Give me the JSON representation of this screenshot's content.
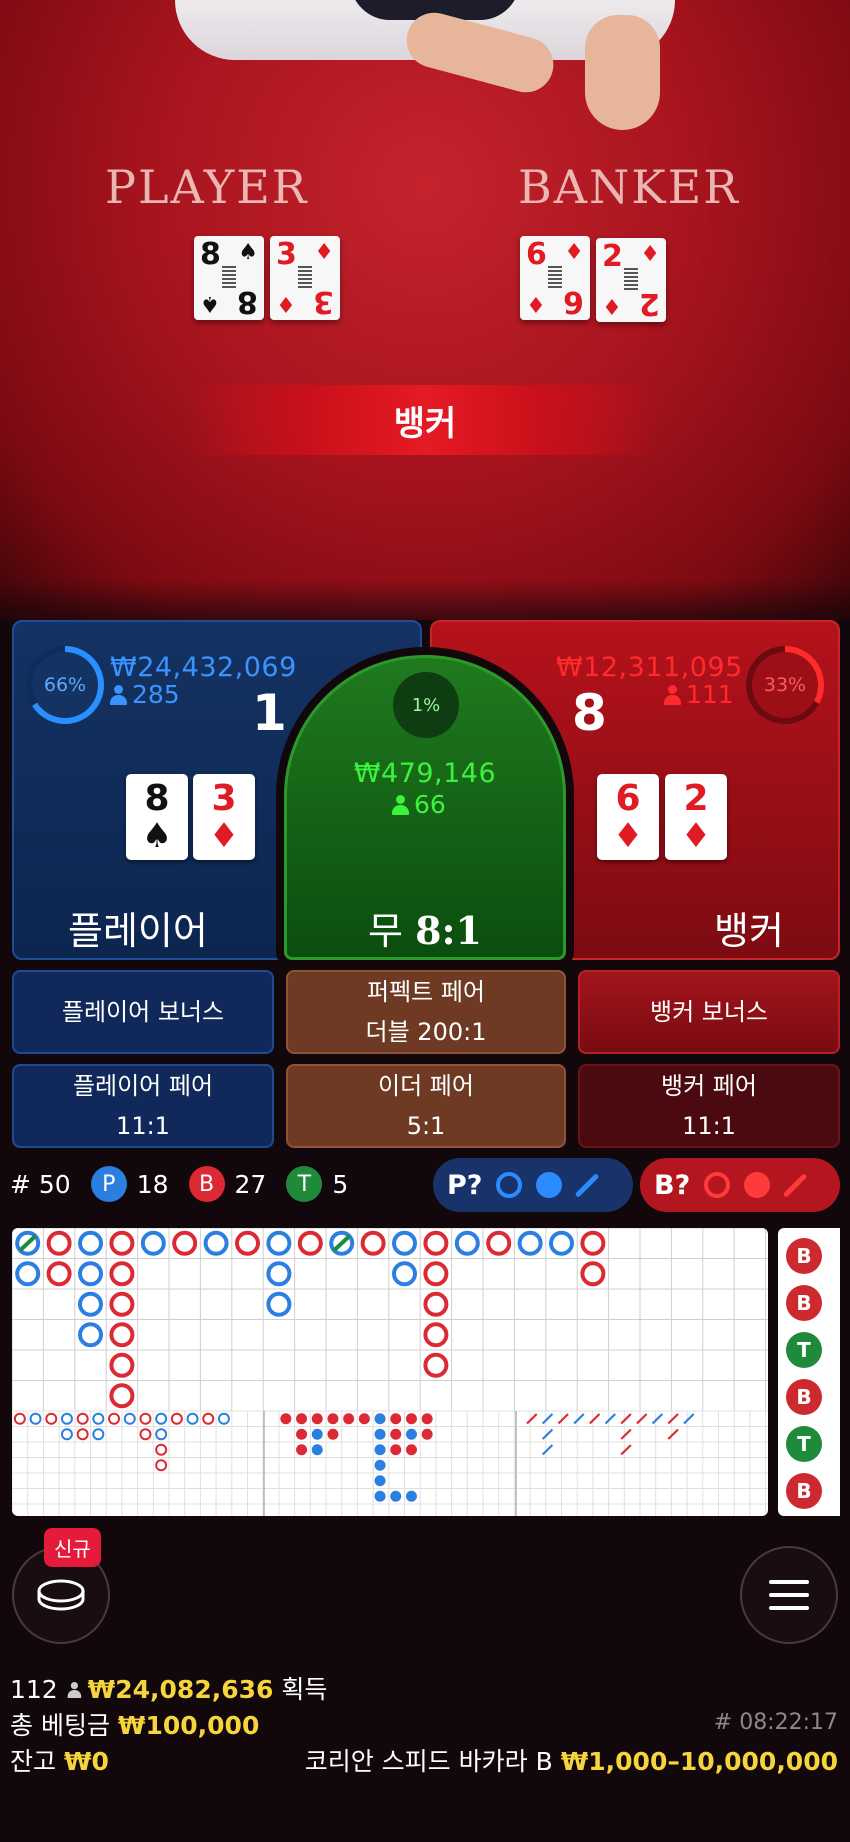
{
  "table": {
    "player_label": "PLAYER",
    "banker_label": "BANKER",
    "result": "뱅커"
  },
  "player": {
    "percent": "66%",
    "amount": "₩24,432,069",
    "count": "285",
    "score": "1",
    "title": "플레이어",
    "cards": [
      {
        "rank": "8",
        "suit": "♠",
        "color": "#111111"
      },
      {
        "rank": "3",
        "suit": "♦",
        "color": "#e01b24"
      }
    ]
  },
  "banker": {
    "percent": "33%",
    "amount": "₩12,311,095",
    "count": "111",
    "score": "8",
    "title": "뱅커",
    "cards": [
      {
        "rank": "6",
        "suit": "♦",
        "color": "#e01b24"
      },
      {
        "rank": "2",
        "suit": "♦",
        "color": "#e01b24"
      }
    ]
  },
  "tie": {
    "percent": "1%",
    "amount": "₩479,146",
    "count": "66",
    "title": "무",
    "odds": "8:1"
  },
  "side_bets": {
    "player_bonus": "플레이어 보너스",
    "perfect_pair": "퍼펙트 페어",
    "perfect_pair_odds": "더블 200:1",
    "banker_bonus": "뱅커 보너스",
    "player_pair": "플레이어 페어",
    "player_pair_odds": "11:1",
    "either_pair": "이더 페어",
    "either_pair_odds": "5:1",
    "banker_pair": "뱅커 페어",
    "banker_pair_odds": "11:1"
  },
  "stats": {
    "round_label": "# 50",
    "p_letter": "P",
    "p_count": "18",
    "b_letter": "B",
    "b_count": "27",
    "t_letter": "T",
    "t_count": "5",
    "p_predict": "P?",
    "b_predict": "B?"
  },
  "colors": {
    "player_blue": "#2a7fe0",
    "banker_red": "#dc2a34",
    "tie_green": "#1e8a3a",
    "gold": "#f6d43b"
  },
  "bead_side": [
    "B",
    "B",
    "T",
    "B",
    "T",
    "B"
  ],
  "bottom": {
    "new_badge": "신규",
    "winners": "112",
    "win_amount": "₩24,082,636",
    "win_suffix": "획득",
    "total_bet_label": "총 베팅금",
    "total_bet": "₩100,000",
    "balance_label": "잔고",
    "balance": "₩0",
    "time": "# 08:22:17",
    "table_name": "코리안 스피드 바카라 B",
    "limits": "₩1,000–10,000,000"
  },
  "icons": {
    "chip": "chip-stack-icon",
    "menu": "hamburger-menu-icon"
  }
}
